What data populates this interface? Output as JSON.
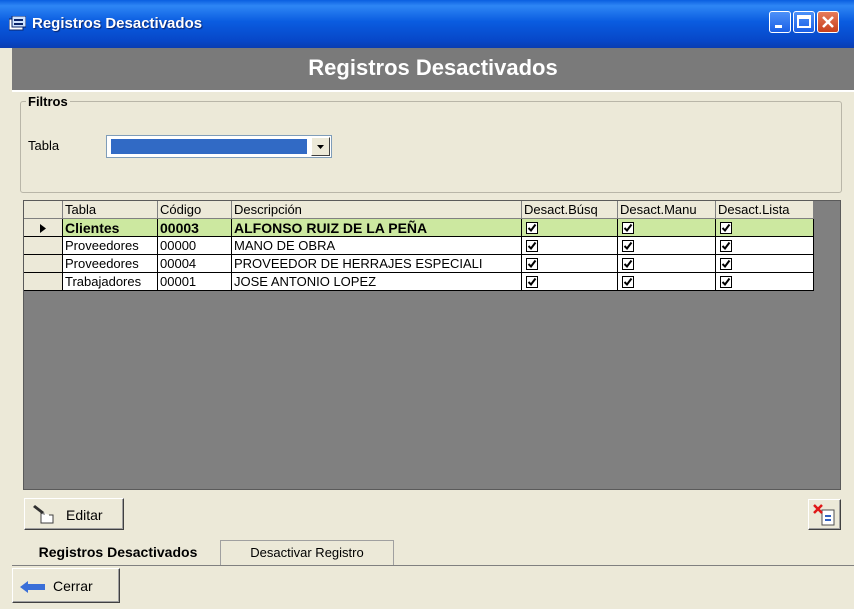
{
  "window": {
    "title": "Registros Desactivados"
  },
  "header": {
    "title": "Registros Desactivados"
  },
  "filters": {
    "legend": "Filtros",
    "table_label": "Tabla",
    "table_value": ""
  },
  "grid": {
    "columns": [
      "Tabla",
      "Código",
      "Descripción",
      "Desact.Búsq",
      "Desact.Manu",
      "Desact.Lista"
    ],
    "rows": [
      {
        "tabla": "Clientes",
        "codigo": "00003",
        "descripcion": "ALFONSO RUIZ DE LA PEÑA",
        "busq": true,
        "manu": true,
        "lista": true,
        "selected": true
      },
      {
        "tabla": "Proveedores",
        "codigo": "00000",
        "descripcion": "MANO DE OBRA",
        "busq": true,
        "manu": true,
        "lista": true,
        "selected": false
      },
      {
        "tabla": "Proveedores",
        "codigo": "00004",
        "descripcion": "PROVEEDOR DE HERRAJES ESPECIALI",
        "busq": true,
        "manu": true,
        "lista": true,
        "selected": false
      },
      {
        "tabla": "Trabajadores",
        "codigo": "00001",
        "descripcion": "JOSE ANTONIO LOPEZ",
        "busq": true,
        "manu": true,
        "lista": true,
        "selected": false
      }
    ]
  },
  "toolbar": {
    "edit_label": "Editar",
    "delete_icon": "delete-document-icon"
  },
  "tabs": [
    {
      "label": "Registros Desactivados",
      "active": true
    },
    {
      "label": "Desactivar Registro",
      "active": false
    }
  ],
  "footer": {
    "close_label": "Cerrar"
  },
  "colors": {
    "selected_row": "#cce8a0",
    "header_bar": "#7a7a7a",
    "titlebar": "#0a5ce0"
  }
}
